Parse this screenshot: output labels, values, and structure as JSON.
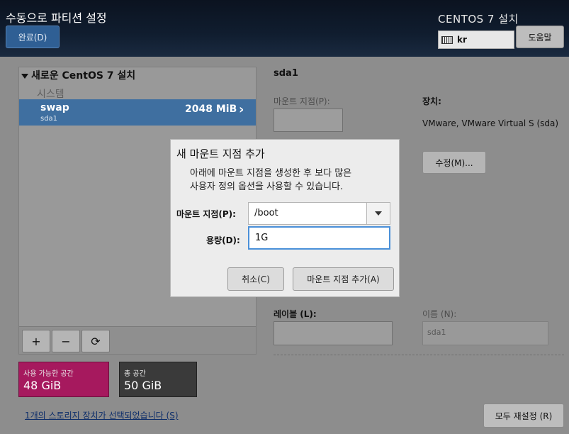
{
  "header": {
    "page_title": "수동으로 파티션 설정",
    "done_label": "완료(D)",
    "install_title": "CENTOS 7 설치",
    "keyboard_layout": "kr",
    "help_label": "도움말"
  },
  "left_panel": {
    "group_title": "새로운 CentOS 7 설치",
    "system_label": "시스템",
    "selected_item": {
      "name": "swap",
      "device": "sda1",
      "size": "2048 MiB"
    },
    "add_icon": "+",
    "remove_icon": "−",
    "refresh_icon": "⟳"
  },
  "capacity": {
    "available_label": "사용 가능한 공간",
    "available_value": "48 GiB",
    "total_label": "총 공간",
    "total_value": "50 GiB"
  },
  "storage_link": "1개의 스토리지 장치가 선택되었습니다 (S)",
  "reset_label": "모두 재설정 (R)",
  "right_panel": {
    "title": "sda1",
    "mount_point_label": "마운트 지점(P):",
    "device_heading": "장치:",
    "device_value": "VMware, VMware Virtual S (sda)",
    "modify_label": "수정(M)...",
    "label_label": "레이블 (L):",
    "name_label": "이름 (N):",
    "name_value": "sda1"
  },
  "dialog": {
    "title": "새 마운트 지점 추가",
    "description_line1": "아래에 마운트 지점을 생성한 후 보다 많은",
    "description_line2": "사용자 정의 옵션을 사용할 수 있습니다.",
    "mount_point_label": "마운트 지점(P):",
    "mount_point_value": "/boot",
    "capacity_label": "용량(D):",
    "capacity_value": "1G",
    "cancel_label": "취소(C)",
    "add_label": "마운트 지점 추가(A)"
  },
  "colors": {
    "selection": "#3f6fa0",
    "available": "#a6195e",
    "total": "#3a3a3a",
    "focus": "#4a90d9"
  }
}
